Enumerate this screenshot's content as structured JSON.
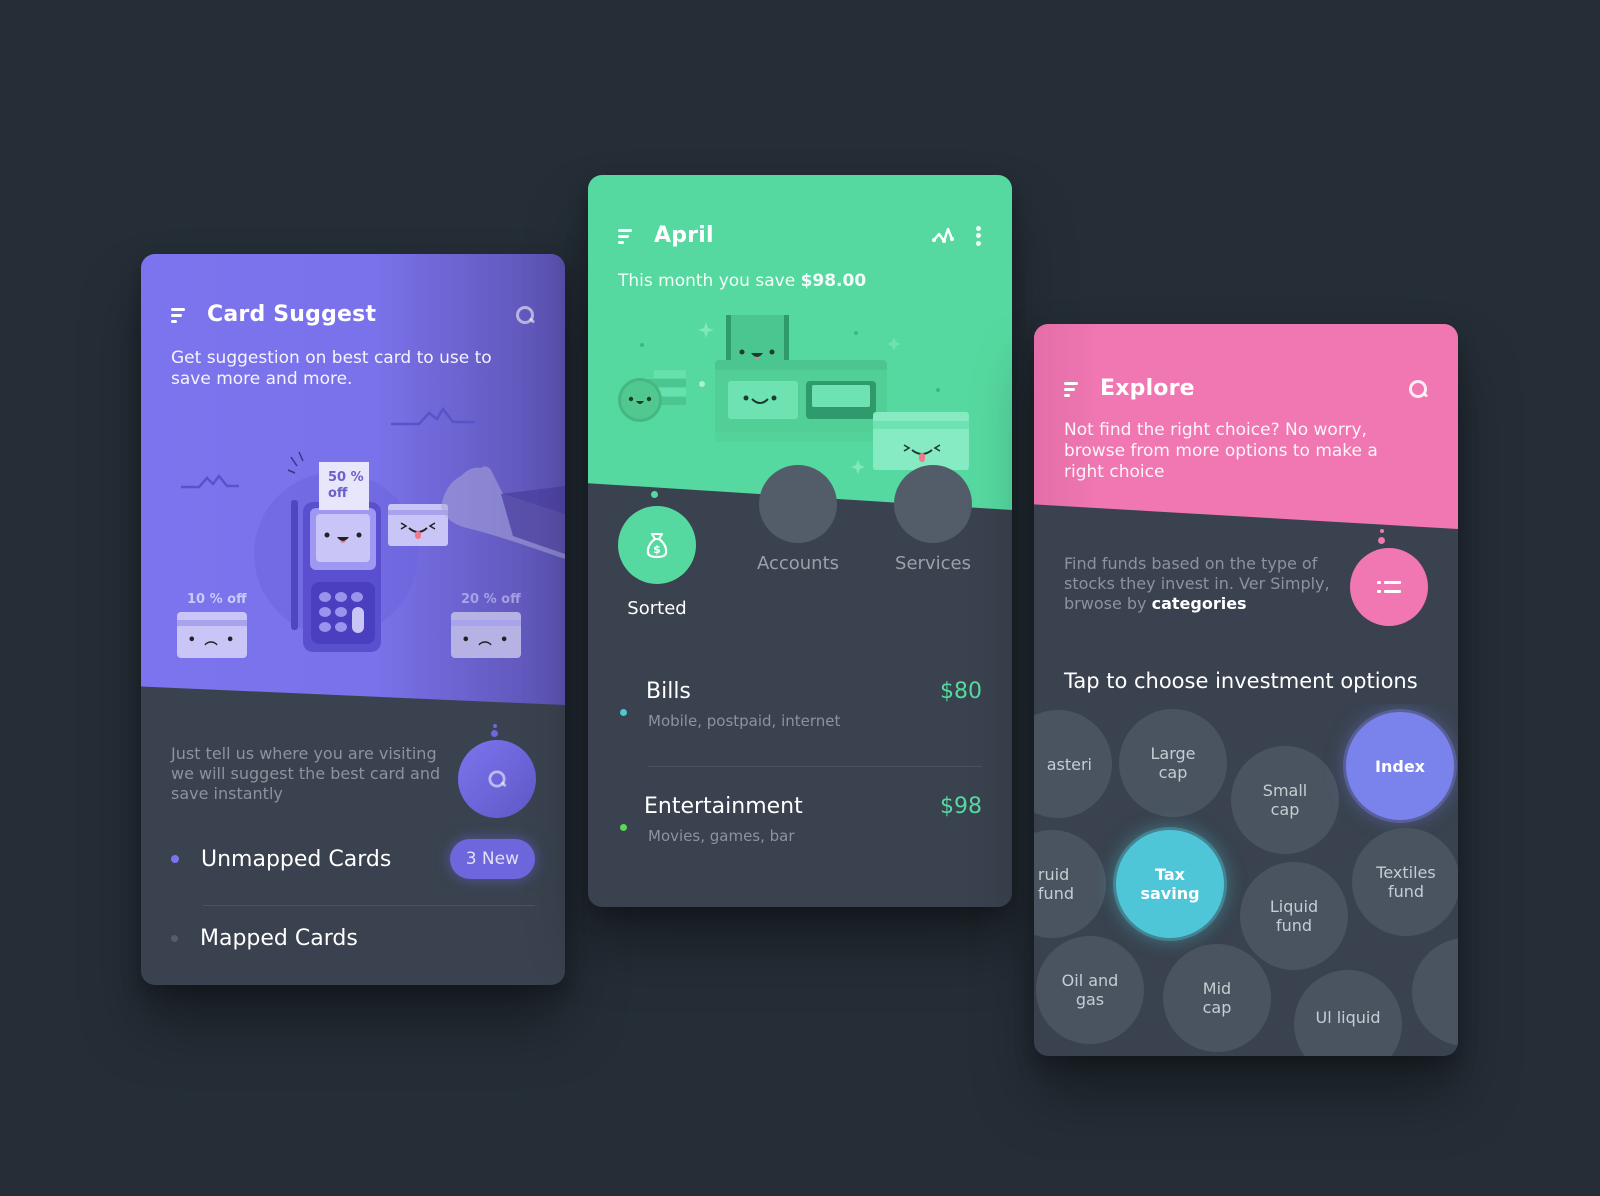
{
  "colors": {
    "background": "#252e37",
    "card_body": "#39424e",
    "purple": "#7c74ee",
    "green": "#56d9a0",
    "pink": "#f077b1",
    "index_bubble": "#7a82eb",
    "tax_bubble": "#4fc6d8",
    "bubble": "#4a5461"
  },
  "card_suggest": {
    "title": "Card Suggest",
    "subtitle": "Get suggestion on best card to use to save more and more.",
    "illustration": {
      "receipt_label_line1": "50 %",
      "receipt_label_line2": "off",
      "left_card_tag": "10 % off",
      "right_card_tag": "20 % off"
    },
    "description": "Just tell us where you are visiting we will suggest the best card and save instantly",
    "list": [
      {
        "label": "Unmapped Cards",
        "badge": "3 New",
        "active": true
      },
      {
        "label": "Mapped Cards",
        "badge": null,
        "active": false
      }
    ]
  },
  "savings": {
    "title": "April",
    "subtitle_prefix": "This month you save ",
    "subtitle_amount": "$98.00",
    "tabs": [
      {
        "label": "Sorted",
        "icon": "money-bag-icon",
        "active": true
      },
      {
        "label": "Accounts",
        "active": false
      },
      {
        "label": "Services",
        "active": false
      }
    ],
    "transactions": [
      {
        "name": "Bills",
        "detail": "Mobile, postpaid, internet",
        "amount": "$80",
        "dot_color": "#4fc6d8"
      },
      {
        "name": "Entertainment",
        "detail": "Movies, games, bar",
        "amount": "$98",
        "dot_color": "#5fd35a"
      }
    ]
  },
  "explore": {
    "title": "Explore",
    "subtitle": "Not find the right choice? No worry, browse from more options to make a right choice",
    "description_prefix": "Find funds based on the type of stocks they invest in. Ver Simply, brwose by ",
    "description_bold": "categories",
    "heading": "Tap to choose investment options",
    "options": [
      {
        "line1": "asteri",
        "line2": ""
      },
      {
        "line1": "Large",
        "line2": "cap"
      },
      {
        "line1": "Small",
        "line2": "cap"
      },
      {
        "line1": "Index",
        "line2": "",
        "selected": true
      },
      {
        "line1": "ruid",
        "line2": "fund"
      },
      {
        "line1": "Tax",
        "line2": "saving",
        "selected": true
      },
      {
        "line1": "Liquid",
        "line2": "fund"
      },
      {
        "line1": "Textiles",
        "line2": "fund"
      },
      {
        "line1": "Oil and",
        "line2": "gas"
      },
      {
        "line1": "Mid",
        "line2": "cap"
      },
      {
        "line1": "Ul liquid",
        "line2": ""
      },
      {
        "line1": "",
        "line2": ""
      }
    ]
  }
}
